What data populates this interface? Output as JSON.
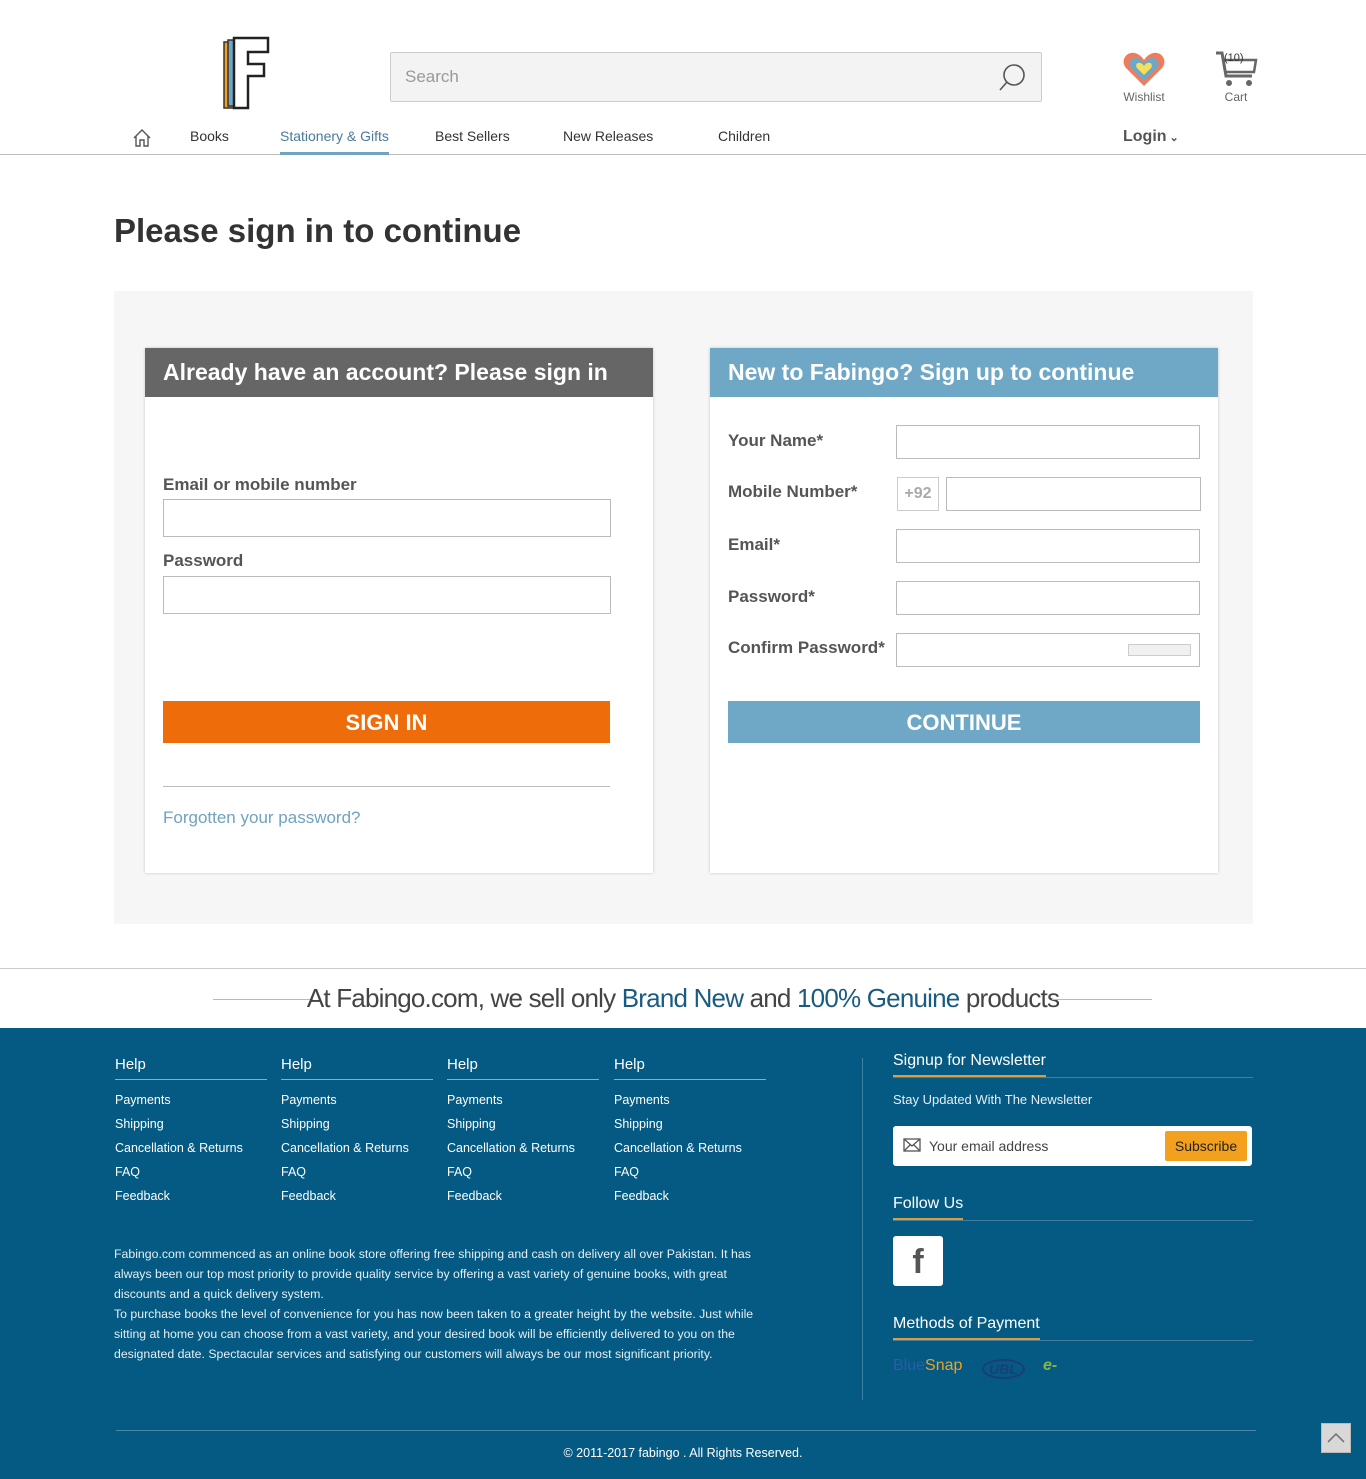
{
  "search": {
    "placeholder": "Search"
  },
  "header": {
    "wishlist_label": "Wishlist",
    "cart_label": "Cart",
    "cart_count": "(10)",
    "login_label": "Login"
  },
  "nav": {
    "items": [
      "Books",
      "Stationery & Gifts",
      "Best Sellers",
      "New Releases",
      "Children"
    ],
    "active": "Stationery & Gifts"
  },
  "page_title": "Please sign in to continue",
  "signin": {
    "heading": "Already have an account? Please sign in",
    "email_label": "Email or mobile number",
    "password_label": "Password",
    "button": "SIGN IN",
    "forgot": "Forgotten your password?"
  },
  "signup": {
    "heading": "New to Fabingo? Sign up to continue",
    "name_label": "Your Name*",
    "mobile_label": "Mobile Number*",
    "mobile_prefix": "+92",
    "email_label": "Email*",
    "password_label": "Password*",
    "confirm_label": "Confirm Password*",
    "button": "CONTINUE"
  },
  "banner": {
    "t1": "At Fabingo.com, we sell only ",
    "h1": "Brand New",
    "t2": " and ",
    "h2": "100% Genuine",
    "t3": " products"
  },
  "footer": {
    "columns": [
      {
        "heading": "Help",
        "links": [
          "Payments",
          "Shipping",
          "Cancellation & Returns",
          "FAQ",
          "Feedback"
        ]
      },
      {
        "heading": "Help",
        "links": [
          "Payments",
          "Shipping",
          "Cancellation & Returns",
          "FAQ",
          "Feedback"
        ]
      },
      {
        "heading": "Help",
        "links": [
          "Payments",
          "Shipping",
          "Cancellation & Returns",
          "FAQ",
          "Feedback"
        ]
      },
      {
        "heading": "Help",
        "links": [
          "Payments",
          "Shipping",
          "Cancellation & Returns",
          "FAQ",
          "Feedback"
        ]
      }
    ],
    "about_p1": "Fabingo.com commenced as an online book store offering free shipping and cash on delivery all over Pakistan. It has always been our top most priority to provide quality service by offering a vast variety of genuine books, with great discounts and a quick delivery system.",
    "about_p2": "To purchase books  the level of convenience for you has now been taken to a greater height by the website. Just while sitting at home you can choose from a vast variety, and your desired book will be efficiently delivered to you on the designated date. Spectacular services and satisfying our customers will always be our most significant priority.",
    "newsletter_heading": "Signup for Newsletter",
    "newsletter_text": "Stay Updated With The Newsletter",
    "newsletter_placeholder": "Your email address",
    "subscribe": "Subscribe",
    "follow_heading": "Follow Us",
    "facebook": "f",
    "payment_heading": "Methods of Payment",
    "pay_bluesnap_1": "Blue",
    "pay_bluesnap_2": "Snap",
    "pay_ubl": "UBL",
    "pay_epay": "e-",
    "copyright": "© 2011-2017 fabingo . All Rights Reserved."
  },
  "colors": {
    "accent": "#6fa8c6",
    "signin_button": "#ee6c0a",
    "footer_bg": "#045a82",
    "subscribe": "#f2a01e"
  }
}
